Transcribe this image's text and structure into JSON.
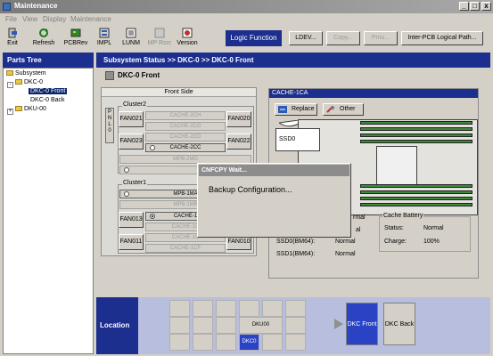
{
  "window": {
    "title": "Maintenance"
  },
  "menu": [
    "File",
    "View",
    "Display",
    "Maintenance"
  ],
  "toolbar": {
    "tools": [
      {
        "label": "Exit",
        "icon": "exit-icon"
      },
      {
        "label": "Refresh",
        "icon": "refresh-icon"
      },
      {
        "label": "PCBRev",
        "icon": "pcbrev-icon"
      },
      {
        "label": "IMPL",
        "icon": "impl-icon"
      },
      {
        "label": "LUNM",
        "icon": "lunm-icon"
      },
      {
        "label": "MP Rsrc",
        "icon": "mp-rsrc-icon"
      },
      {
        "label": "Version",
        "icon": "version-icon"
      }
    ],
    "logic_function_label": "Logic Function",
    "ldev_label": "LDEV...",
    "copy_label": "Copy...",
    "pmu_label": "Pmu...",
    "inter_pcb_label": "Inter-PCB Logical Path..."
  },
  "parts_tree": {
    "header": "Parts Tree",
    "nodes": [
      "Subsystem",
      "DKC-0",
      "DKC-0 Front",
      "DKC-0 Back",
      "DKU-00"
    ],
    "selected": "DKC-0 Front"
  },
  "main": {
    "breadcrumb": "Subsystem Status >> DKC-0 >> DKC-0 Front",
    "page_title": "DKC-0 Front"
  },
  "front_side": {
    "title": "Front Side",
    "pnl_label": "P N L 0",
    "cluster2": {
      "label": "Cluster2",
      "fans": [
        "FAN021",
        "FAN020",
        "FAN023",
        "FAN022"
      ],
      "slots": [
        "CACHE-2CH",
        "CACHE-2CG",
        "CACHE-2CD",
        "CACHE-2CC",
        "MPB-2MD"
      ]
    },
    "cluster1": {
      "label": "Cluster1",
      "fans": [
        "FAN013",
        "FAN011",
        "FAN010"
      ],
      "slots": [
        "MPB-1MA",
        "MPB-1MB",
        "CACHE-1",
        "CACHE-1C",
        "CACHE-1C",
        "CACHE-1CF"
      ]
    }
  },
  "cache_panel": {
    "title": "CACHE-1CA",
    "replace_label": "Replace",
    "other_label": "Other",
    "ssd0_label": "SSD0",
    "info": [
      {
        "label": "SSD0(BM64):",
        "value": "Normal"
      },
      {
        "label": "SSD1(BM64):",
        "value": "Normal"
      }
    ],
    "partial_normal_1": "rmal",
    "partial_normal_2": "al",
    "battery": {
      "title": "Cache Battery",
      "status_label": "Status:",
      "status_value": "Normal",
      "charge_label": "Charge:",
      "charge_value": "100%"
    }
  },
  "dialog": {
    "title": "CNFCPY Wait...",
    "message": "Backup Configuration..."
  },
  "location": {
    "label": "Location",
    "dku_label": "DKU00",
    "dkc_label": "DKC0",
    "front_label": "DKC Front",
    "back_label": "DKC Back",
    "selected": "DKC Front"
  },
  "colors": {
    "header_blue": "#1c2e8e",
    "selected_blue": "#2a43c4",
    "dimm_green": "#3c8a3c"
  }
}
